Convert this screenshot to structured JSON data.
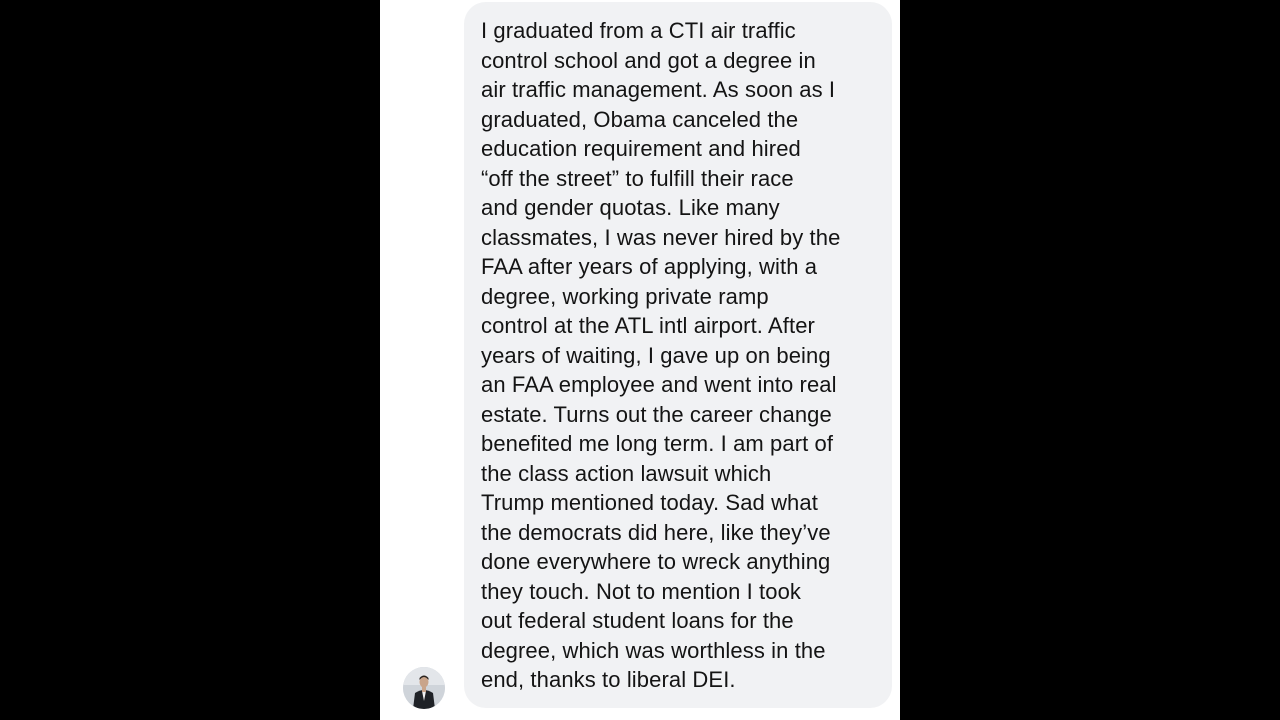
{
  "message": {
    "text": "I graduated from a CTI air traffic\ncontrol school and got a degree in\nair traffic management. As soon as I\ngraduated, Obama canceled the\neducation requirement and hired\n“off the street” to fulfill their race\nand gender quotas. Like many\nclassmates, I was never hired by the\nFAA after years of applying, with a\ndegree, working private ramp\ncontrol at the ATL intl airport. After\nyears of waiting, I gave up on being\nan FAA employee and went into real\nestate. Turns out the career change\nbenefited me long term. I am part of\nthe class action lawsuit which\nTrump mentioned today. Sad what\nthe democrats did here, like they’ve\ndone everywhere to wreck anything\nthey touch. Not to mention I took\nout federal student loans for the\ndegree, which was worthless in the\nend, thanks to liberal DEI."
  },
  "sender": {
    "avatar_icon": "person-in-suit-avatar"
  },
  "colors": {
    "outer_background": "#000000",
    "screen_background": "#ffffff",
    "bubble_background": "#f1f2f4",
    "text": "#141414"
  }
}
